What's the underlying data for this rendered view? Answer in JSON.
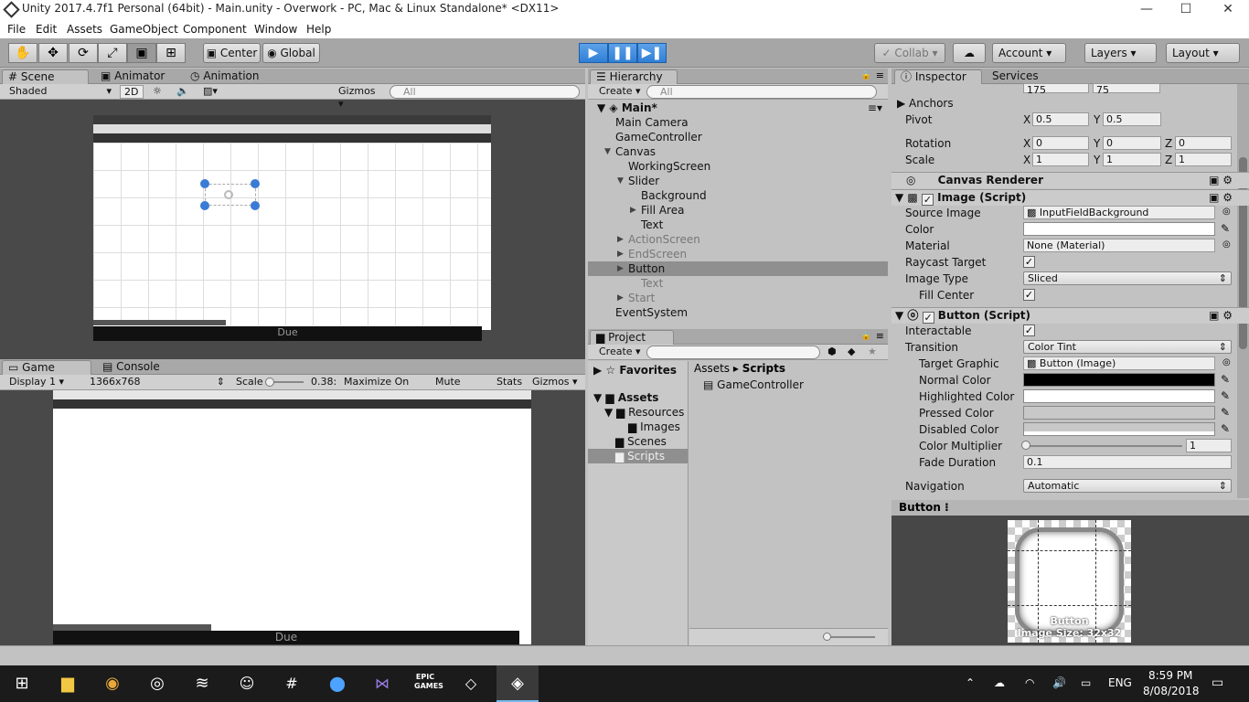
{
  "window": {
    "title": "Unity 2017.4.7f1 Personal (64bit) - Main.unity - Overwork - PC, Mac & Linux Standalone* <DX11>",
    "min": "—",
    "max": "☐",
    "close": "✕"
  },
  "menu": [
    "File",
    "Edit",
    "Assets",
    "GameObject",
    "Component",
    "Window",
    "Help"
  ],
  "toolbar": {
    "tools": [
      "hand",
      "move",
      "rotate",
      "scale",
      "rect",
      "transform"
    ],
    "pivot": "Center",
    "space": "Global",
    "collab": "Collab",
    "account": "Account",
    "layers": "Layers",
    "layout": "Layout"
  },
  "scene": {
    "tabs": [
      "Scene",
      "Animator",
      "Animation"
    ],
    "shading": "Shaded",
    "mode2d": "2D",
    "gizmos": "Gizmos",
    "search_placeholder": "All",
    "bottom_text": "Due"
  },
  "game": {
    "tabs": [
      "Game",
      "Console"
    ],
    "display": "Display 1",
    "resolution": "1366x768",
    "scale_label": "Scale",
    "scale_value": "0.38:",
    "maximize": "Maximize On Play",
    "mute": "Mute Audio",
    "stats": "Stats",
    "gizmos": "Gizmos",
    "bottom_text": "Due"
  },
  "hierarchy": {
    "tab": "Hierarchy",
    "create": "Create",
    "search_placeholder": "All",
    "scene_name": "Main*",
    "items": [
      {
        "label": "Main Camera",
        "indent": 0,
        "arrow": "",
        "state": "normal"
      },
      {
        "label": "GameController",
        "indent": 0,
        "arrow": "",
        "state": "normal"
      },
      {
        "label": "Canvas",
        "indent": 0,
        "arrow": "▼",
        "state": "normal"
      },
      {
        "label": "WorkingScreen",
        "indent": 1,
        "arrow": "",
        "state": "normal"
      },
      {
        "label": "Slider",
        "indent": 1,
        "arrow": "▼",
        "state": "normal"
      },
      {
        "label": "Background",
        "indent": 2,
        "arrow": "",
        "state": "normal"
      },
      {
        "label": "Fill Area",
        "indent": 2,
        "arrow": "▶",
        "state": "normal"
      },
      {
        "label": "Text",
        "indent": 2,
        "arrow": "",
        "state": "normal"
      },
      {
        "label": "ActionScreen",
        "indent": 1,
        "arrow": "▶",
        "state": "disabled"
      },
      {
        "label": "EndScreen",
        "indent": 1,
        "arrow": "▶",
        "state": "disabled"
      },
      {
        "label": "Button",
        "indent": 1,
        "arrow": "▶",
        "state": "selected"
      },
      {
        "label": "Text",
        "indent": 2,
        "arrow": "",
        "state": "disabled"
      },
      {
        "label": "Start",
        "indent": 1,
        "arrow": "▶",
        "state": "disabled"
      },
      {
        "label": "EventSystem",
        "indent": 0,
        "arrow": "",
        "state": "normal"
      }
    ]
  },
  "project": {
    "tab": "Project",
    "create": "Create",
    "favorites": "Favorites",
    "assets": "Assets",
    "tree": [
      "Resources",
      "Images",
      "Scenes",
      "Scripts"
    ],
    "breadcrumb": [
      "Assets",
      "Scripts"
    ],
    "files": [
      "GameController"
    ]
  },
  "inspector": {
    "tabs": [
      "Inspector",
      "Services"
    ],
    "top_values": [
      "175",
      "75"
    ],
    "anchors": "Anchors",
    "pivot": {
      "label": "Pivot",
      "x": "0.5",
      "y": "0.5"
    },
    "rotation": {
      "label": "Rotation",
      "x": "0",
      "y": "0",
      "z": "0"
    },
    "scale": {
      "label": "Scale",
      "x": "1",
      "y": "1",
      "z": "1"
    },
    "axis": {
      "x": "X",
      "y": "Y",
      "z": "Z"
    },
    "canvas_renderer": "Canvas Renderer",
    "image": {
      "header": "Image (Script)",
      "source_image_label": "Source Image",
      "source_image": "InputFieldBackground",
      "color_label": "Color",
      "material_label": "Material",
      "material": "None (Material)",
      "raycast_label": "Raycast Target",
      "image_type_label": "Image Type",
      "image_type": "Sliced",
      "fill_center_label": "Fill Center"
    },
    "button": {
      "header": "Button (Script)",
      "interactable_label": "Interactable",
      "transition_label": "Transition",
      "transition": "Color Tint",
      "target_graphic_label": "Target Graphic",
      "target_graphic": "Button (Image)",
      "normal_color_label": "Normal Color",
      "highlighted_color_label": "Highlighted Color",
      "pressed_color_label": "Pressed Color",
      "disabled_color_label": "Disabled Color",
      "multiplier_label": "Color Multiplier",
      "multiplier": "1",
      "fade_label": "Fade Duration",
      "fade": "0.1",
      "navigation_label": "Navigation",
      "navigation": "Automatic"
    },
    "preview": {
      "title": "Button",
      "name": "Button",
      "size": "Image Size: 32x32"
    }
  },
  "taskbar": {
    "language": "ENG",
    "time": "8:59 PM",
    "date": "8/08/2018",
    "epic": "EPIC GAMES"
  },
  "colors": {
    "play_blue": "#3b8be0",
    "selection": "#8f8f8f",
    "taskbar": "#1b1b1b"
  }
}
